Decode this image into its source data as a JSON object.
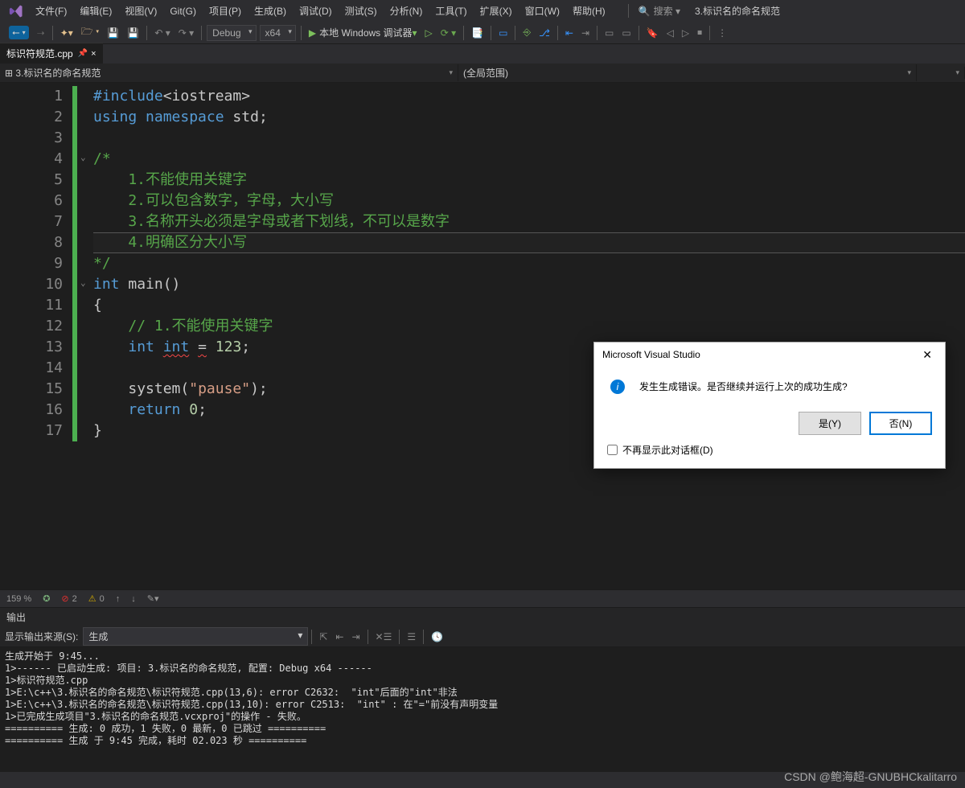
{
  "menubar": [
    "文件(F)",
    "编辑(E)",
    "视图(V)",
    "Git(G)",
    "项目(P)",
    "生成(B)",
    "调试(D)",
    "测试(S)",
    "分析(N)",
    "工具(T)",
    "扩展(X)",
    "窗口(W)",
    "帮助(H)"
  ],
  "search_placeholder": "搜索 ▾",
  "solution_name": "3.标识名的命名规范",
  "toolbar": {
    "config": "Debug",
    "platform": "x64",
    "debug_label": "本地 Windows 调试器"
  },
  "tab": {
    "filename": "标识符规范.cpp"
  },
  "navbar": {
    "left_icon": "⊞",
    "left": "3.标识名的命名规范",
    "right": "(全局范围)"
  },
  "code_lines": [
    {
      "n": 1,
      "html": "<span class='kw'>#include</span><span class='text'>&lt;iostream&gt;</span>"
    },
    {
      "n": 2,
      "html": "<span class='kw'>using</span> <span class='kw'>namespace</span> <span class='text'>std</span><span class='text'>;</span>"
    },
    {
      "n": 3,
      "html": ""
    },
    {
      "n": 4,
      "chev": true,
      "html": "<span class='comment'>/*</span>"
    },
    {
      "n": 5,
      "html": "<span class='comment'>    1.不能使用关键字</span>"
    },
    {
      "n": 6,
      "html": "<span class='comment'>    2.可以包含数字，字母，大小写</span>"
    },
    {
      "n": 7,
      "html": "<span class='comment'>    3.名称开头必须是字母或者下划线，不可以是数字</span>"
    },
    {
      "n": 8,
      "hl": true,
      "html": "<span class='comment'>    4.明确区分大小写</span>"
    },
    {
      "n": 9,
      "html": "<span class='comment'>*/</span>"
    },
    {
      "n": 10,
      "chev": true,
      "html": "<span class='type'>int</span> <span class='fn'>main</span><span class='text'>()</span>"
    },
    {
      "n": 11,
      "html": "<span class='text'>{</span>"
    },
    {
      "n": 12,
      "html": "    <span class='comment'>// 1.不能使用关键字</span>"
    },
    {
      "n": 13,
      "html": "    <span class='type'>int</span> <span class='type squiggle'>int</span> <span class='text squiggle'>=</span> <span class='num'>123</span><span class='text'>;</span>"
    },
    {
      "n": 14,
      "html": ""
    },
    {
      "n": 15,
      "html": "    <span class='fn'>system</span><span class='text'>(</span><span class='str'>\"pause\"</span><span class='text'>);</span>"
    },
    {
      "n": 16,
      "html": "    <span class='kw'>return</span> <span class='num'>0</span><span class='text'>;</span>"
    },
    {
      "n": 17,
      "html": "<span class='text'>}</span>"
    }
  ],
  "editor_status": {
    "zoom": "159 %",
    "errors": "2",
    "warnings": "0"
  },
  "output": {
    "title": "输出",
    "source_label": "显示输出来源(S):",
    "source_value": "生成",
    "lines": [
      "生成开始于 9:45...",
      "1>------ 已启动生成: 项目: 3.标识名的命名规范, 配置: Debug x64 ------",
      "1>标识符规范.cpp",
      "1>E:\\c++\\3.标识名的命名规范\\标识符规范.cpp(13,6): error C2632:  \"int\"后面的\"int\"非法",
      "1>E:\\c++\\3.标识名的命名规范\\标识符规范.cpp(13,10): error C2513:  \"int\" : 在\"=\"前没有声明变量",
      "1>已完成生成项目\"3.标识名的命名规范.vcxproj\"的操作 - 失败。",
      "========== 生成: 0 成功，1 失败，0 最新，0 已跳过 ==========",
      "========== 生成 于 9:45 完成，耗时 02.023 秒 =========="
    ]
  },
  "dialog": {
    "title": "Microsoft Visual Studio",
    "message": "发生生成错误。是否继续并运行上次的成功生成?",
    "yes": "是(Y)",
    "no": "否(N)",
    "dontshow": "不再显示此对话框(D)"
  },
  "watermark": "CSDN @鲍海超-GNUBHCkalitarro"
}
